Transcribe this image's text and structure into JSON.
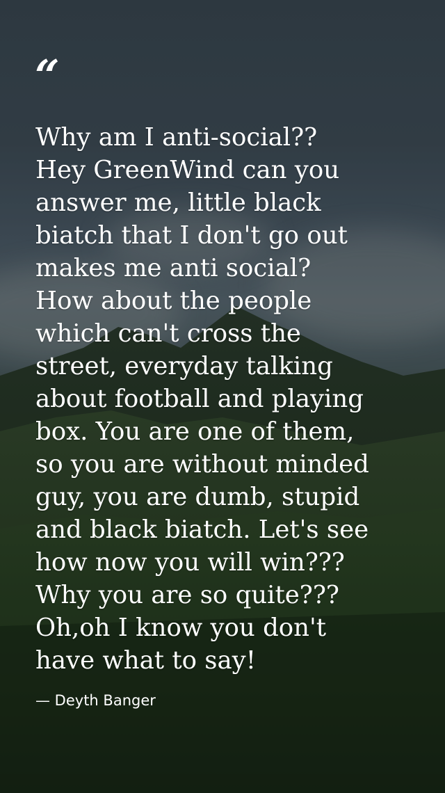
{
  "quote": {
    "mark": "“",
    "text": "Why am I anti-social??\nHey GreenWind can you\nanswer me, little black\nbiatch that I don't go out\nmakes me anti social?\nHow about the people\nwhich can't cross the\nstreet, everyday talking\nabout football and playing\nbox. You are one of them,\nso you are without minded\nguy, you are dumb, stupid\nand black biatch. Let's see\nhow now you will win???\nWhy you are so quite???\nOh,oh I know you don't\nhave what to say!",
    "author": "— Deyth Banger"
  },
  "colors": {
    "text": "#ffffff",
    "sky": "#3c4a54",
    "vegetation": "#1b2a19"
  }
}
